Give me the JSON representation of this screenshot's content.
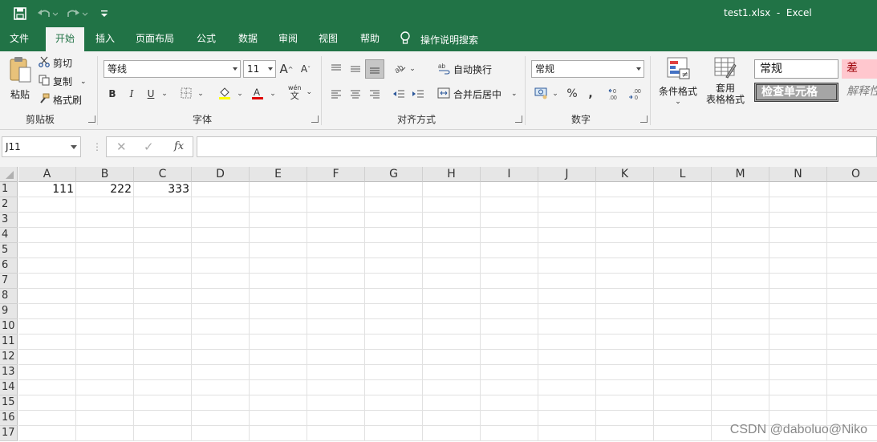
{
  "title_bar": {
    "file_name": "test1.xlsx  -  Excel",
    "bg_color": "#217346"
  },
  "tabs": [
    {
      "label": "文件"
    },
    {
      "label": "开始",
      "active": true
    },
    {
      "label": "插入"
    },
    {
      "label": "页面布局"
    },
    {
      "label": "公式"
    },
    {
      "label": "数据"
    },
    {
      "label": "审阅"
    },
    {
      "label": "视图"
    },
    {
      "label": "帮助"
    }
  ],
  "tell_me": "操作说明搜索",
  "clipboard": {
    "paste": "粘贴",
    "cut": "剪切",
    "copy": "复制",
    "format_painter": "格式刷",
    "group": "剪贴板"
  },
  "font": {
    "name": "等线",
    "size": "11",
    "bold": "B",
    "italic": "I",
    "underline": "U",
    "group": "字体",
    "grow": "A",
    "shrink": "A",
    "phonetic_top": "wén",
    "phonetic_bottom": "文"
  },
  "alignment": {
    "wrap_text": "自动换行",
    "merge_center": "合并后居中",
    "group": "对齐方式"
  },
  "number": {
    "format": "常规",
    "percent": "%",
    "comma": ",",
    "group": "数字"
  },
  "styles": {
    "conditional": "条件格式",
    "format_table_top": "套用",
    "format_table_bottom": "表格格式",
    "normal": "常规",
    "bad": "差",
    "check_cell": "检查单元格",
    "explanatory": "解释性"
  },
  "formula_bar": {
    "name_box": "J11",
    "fx": "fx",
    "value": ""
  },
  "columns": [
    "A",
    "B",
    "C",
    "D",
    "E",
    "F",
    "G",
    "H",
    "I",
    "J",
    "K",
    "L",
    "M",
    "N",
    "O"
  ],
  "rows": [
    "1",
    "2",
    "3",
    "4",
    "5",
    "6",
    "7",
    "8",
    "9",
    "10",
    "11",
    "12",
    "13",
    "14",
    "15",
    "16",
    "17"
  ],
  "cells": {
    "A1": "111",
    "B1": "222",
    "C1": "333"
  },
  "watermark": "CSDN @daboluo@Niko"
}
